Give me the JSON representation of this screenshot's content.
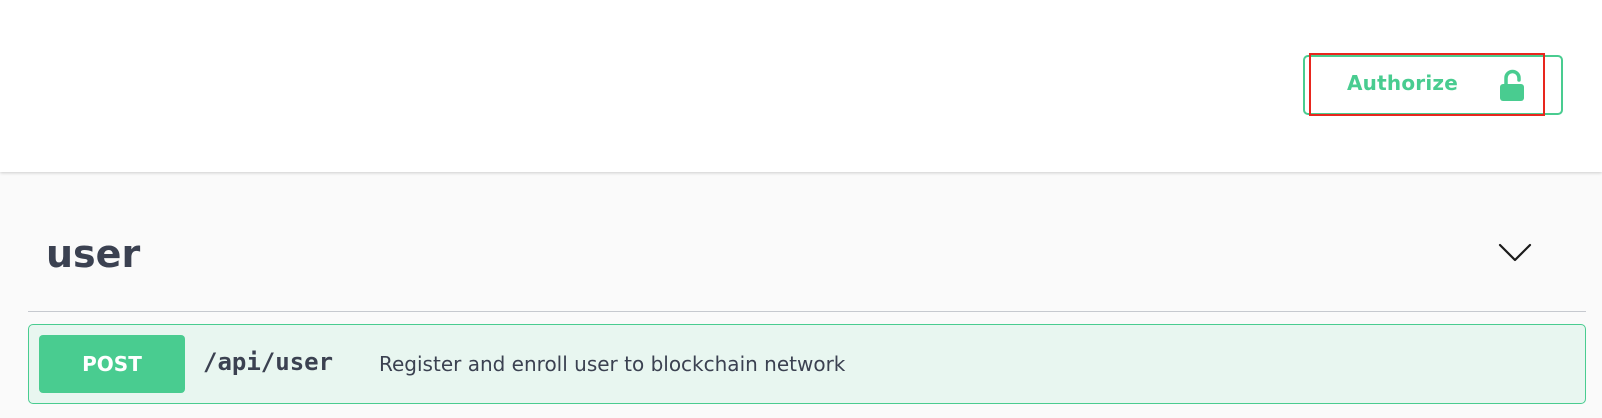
{
  "header": {
    "authorize_label": "Authorize",
    "authorize_icon": "unlocked-padlock-icon"
  },
  "tag": {
    "name": "user",
    "toggle_icon": "chevron-down-icon"
  },
  "operations": [
    {
      "method": "POST",
      "path": "/api/user",
      "summary": "Register and enroll user to blockchain network"
    }
  ],
  "colors": {
    "post_accent": "#49cc90",
    "post_background": "#e8f6f0",
    "text_primary": "#3b4151",
    "highlight_outline": "#e8261e",
    "content_background": "#fafafa"
  }
}
